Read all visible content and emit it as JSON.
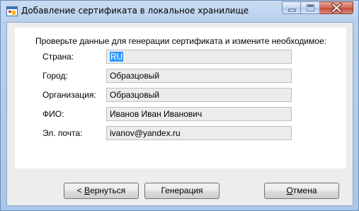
{
  "window": {
    "title": "Добавление сертификата в локальное хранилище",
    "icon": "app-icon"
  },
  "controls": {
    "minimize_icon": "minimize-icon",
    "maximize_icon": "maximize-icon",
    "close_icon": "close-icon"
  },
  "form": {
    "instruction": "Проверьте данные для генерации сертификата и измените необходимое:",
    "fields": [
      {
        "label": "Страна:",
        "value": "RU",
        "selected": true
      },
      {
        "label": "Город:",
        "value": "Образцовый"
      },
      {
        "label": "Организация:",
        "value": "Образцовый"
      },
      {
        "label": "ФИО:",
        "value": "Иванов Иван Иванович"
      },
      {
        "label": "Эл. почта:",
        "value": "ivanov@yandex.ru"
      }
    ]
  },
  "buttons": {
    "back": {
      "prefix": "< ",
      "mnemonic": "В",
      "rest": "ернуться"
    },
    "generate": {
      "label": "Генерация"
    },
    "cancel": {
      "mnemonic": "О",
      "rest": "тмена"
    }
  },
  "colors": {
    "selection": "#3399ff",
    "field_bg": "#ececec",
    "client_bg": "#ededed"
  }
}
